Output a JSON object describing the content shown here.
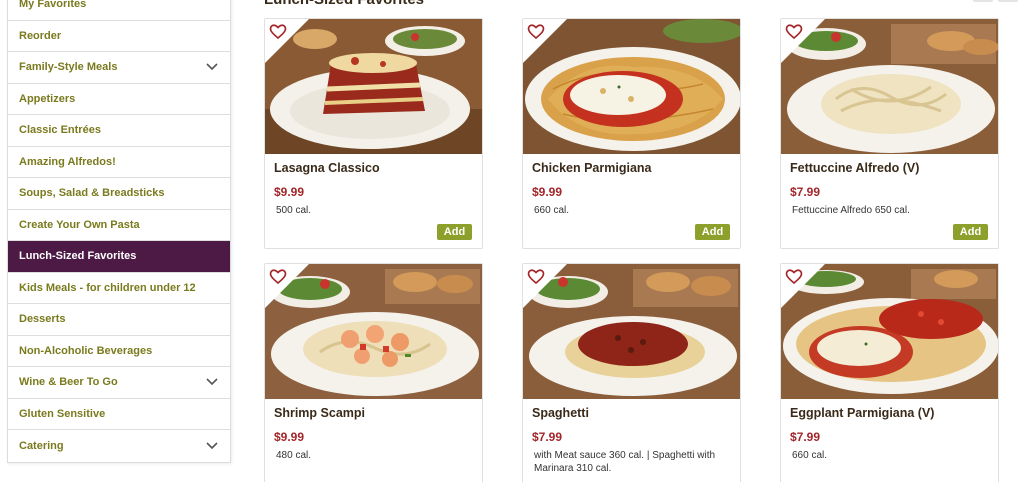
{
  "sidebar": {
    "items": [
      {
        "label": "My Favorites",
        "chevron": false
      },
      {
        "label": "Reorder",
        "chevron": false
      },
      {
        "label": "Family-Style Meals",
        "chevron": true
      },
      {
        "label": "Appetizers",
        "chevron": false
      },
      {
        "label": "Classic Entrées",
        "chevron": false
      },
      {
        "label": "Amazing Alfredos!",
        "chevron": false
      },
      {
        "label": "Soups, Salad & Breadsticks",
        "chevron": false
      },
      {
        "label": "Create Your Own Pasta",
        "chevron": false
      },
      {
        "label": "Lunch-Sized Favorites",
        "chevron": false,
        "active": true
      },
      {
        "label": "Kids Meals - for children under 12",
        "chevron": false
      },
      {
        "label": "Desserts",
        "chevron": false
      },
      {
        "label": "Non-Alcoholic Beverages",
        "chevron": false
      },
      {
        "label": "Wine & Beer To Go",
        "chevron": true
      },
      {
        "label": "Gluten Sensitive",
        "chevron": false
      },
      {
        "label": "Catering",
        "chevron": true
      }
    ]
  },
  "main": {
    "section_title": "Lunch-Sized Favorites",
    "add_label": "Add",
    "cards": [
      {
        "name": "Lasagna Classico",
        "price": "$9.99",
        "calories": "500 cal.",
        "dish": "lasagna"
      },
      {
        "name": "Chicken Parmigiana",
        "price": "$9.99",
        "calories": "660 cal.",
        "dish": "chicken-parm"
      },
      {
        "name": "Fettuccine Alfredo (V)",
        "price": "$7.99",
        "calories": "Fettuccine Alfredo 650 cal.",
        "dish": "alfredo"
      },
      {
        "name": "Shrimp Scampi",
        "price": "$9.99",
        "calories": "480 cal.",
        "dish": "scampi"
      },
      {
        "name": "Spaghetti",
        "price": "$7.99",
        "calories": "with Meat sauce 360 cal. | Spaghetti with Marinara 310 cal.",
        "dish": "spaghetti"
      },
      {
        "name": "Eggplant Parmigiana (V)",
        "price": "$7.99",
        "calories": "660 cal.",
        "dish": "eggplant"
      }
    ]
  },
  "colors": {
    "sidebar_text": "#7a7a1e",
    "active_bg": "#4c1a44",
    "price": "#a3262a",
    "add_button": "#8ea02c",
    "heart": "#a3262a"
  },
  "icons": {
    "chevron": "chevron-down-icon",
    "favorite": "heart-outline-icon"
  }
}
